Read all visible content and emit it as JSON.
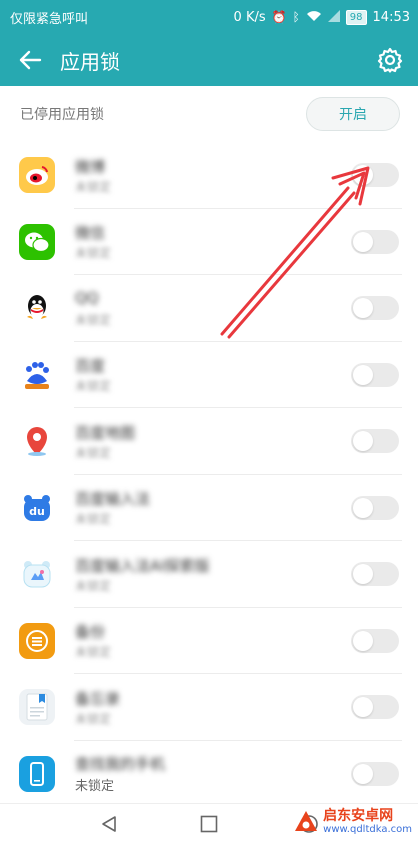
{
  "status_bar": {
    "carrier": "仅限紧急呼叫",
    "speed": "0 K/s",
    "battery": "98",
    "time": "14:53"
  },
  "app_bar": {
    "title": "应用锁"
  },
  "section": {
    "label": "已停用应用锁",
    "enable_button": "开启"
  },
  "apps": [
    {
      "name": "微博",
      "status": "未锁定",
      "icon": "weibo-icon",
      "color": "#f5a623"
    },
    {
      "name": "微信",
      "status": "未锁定",
      "icon": "wechat-icon",
      "color": "#2dc100"
    },
    {
      "name": "QQ",
      "status": "未锁定",
      "icon": "qq-icon",
      "color": "#000000"
    },
    {
      "name": "百度",
      "status": "未锁定",
      "icon": "baidu-icon",
      "color": "#2e61e8"
    },
    {
      "name": "百度地图",
      "status": "未锁定",
      "icon": "baidu-map-icon",
      "color": "#e8463c"
    },
    {
      "name": "百度输入法",
      "status": "未锁定",
      "icon": "baidu-input-icon",
      "color": "#2f7be5"
    },
    {
      "name": "百度输入法AI探索版",
      "status": "未锁定",
      "icon": "baidu-input-ai-icon",
      "color": "#b7e1f2"
    },
    {
      "name": "备份",
      "status": "未锁定",
      "icon": "backup-icon",
      "color": "#f29b11"
    },
    {
      "name": "备忘录",
      "status": "未锁定",
      "icon": "memo-icon",
      "color": "#e9eef2"
    },
    {
      "name": "查找我的手机",
      "status": "未锁定",
      "icon": "find-phone-icon",
      "color": "#1aa0e0"
    }
  ],
  "watermark": {
    "name": "启东安卓网",
    "url": "www.qdltdka.com"
  },
  "colors": {
    "accent": "#27a9b1",
    "arrow": "#e8383d"
  }
}
